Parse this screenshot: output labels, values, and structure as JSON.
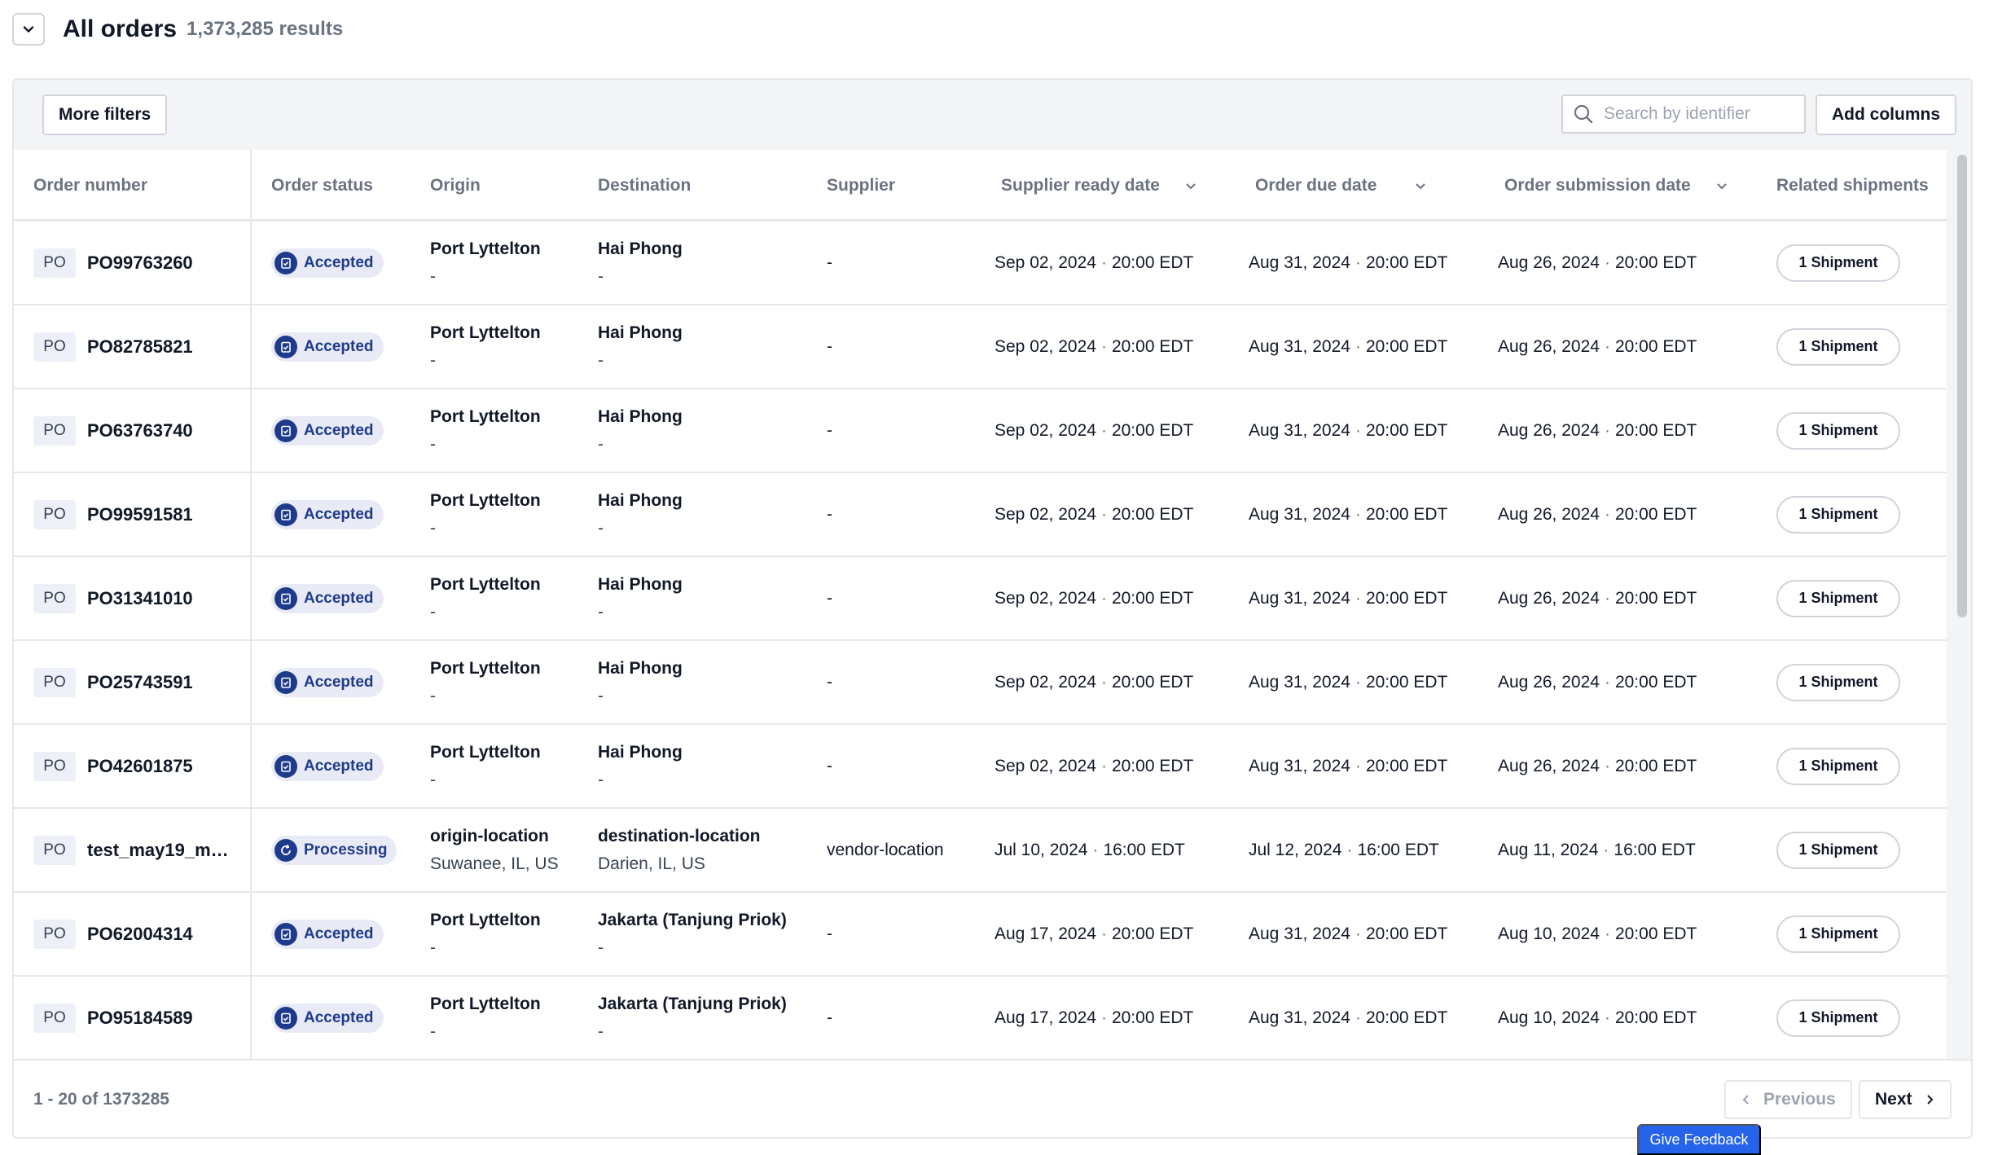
{
  "header": {
    "title": "All orders",
    "results": "1,373,285 results"
  },
  "toolbar": {
    "more_filters": "More filters",
    "search_placeholder": "Search by identifier",
    "add_columns": "Add columns"
  },
  "columns": {
    "order_number": "Order number",
    "order_status": "Order status",
    "origin": "Origin",
    "destination": "Destination",
    "supplier": "Supplier",
    "supplier_ready_date": "Supplier ready date",
    "order_due_date": "Order due date",
    "order_submission_date": "Order submission date",
    "related_shipments": "Related shipments"
  },
  "rows": [
    {
      "tag": "PO",
      "number": "PO99763260",
      "status": "Accepted",
      "status_icon": "clipboard-check-icon",
      "origin": "Port Lyttelton",
      "origin_sub": "-",
      "dest": "Hai Phong",
      "dest_sub": "-",
      "supplier": "-",
      "ready": "Sep 02, 2024",
      "ready_t": "20:00 EDT",
      "due": "Aug 31, 2024",
      "due_t": "20:00 EDT",
      "sub": "Aug 26, 2024",
      "sub_t": "20:00 EDT",
      "ship": "1 Shipment"
    },
    {
      "tag": "PO",
      "number": "PO82785821",
      "status": "Accepted",
      "status_icon": "clipboard-check-icon",
      "origin": "Port Lyttelton",
      "origin_sub": "-",
      "dest": "Hai Phong",
      "dest_sub": "-",
      "supplier": "-",
      "ready": "Sep 02, 2024",
      "ready_t": "20:00 EDT",
      "due": "Aug 31, 2024",
      "due_t": "20:00 EDT",
      "sub": "Aug 26, 2024",
      "sub_t": "20:00 EDT",
      "ship": "1 Shipment"
    },
    {
      "tag": "PO",
      "number": "PO63763740",
      "status": "Accepted",
      "status_icon": "clipboard-check-icon",
      "origin": "Port Lyttelton",
      "origin_sub": "-",
      "dest": "Hai Phong",
      "dest_sub": "-",
      "supplier": "-",
      "ready": "Sep 02, 2024",
      "ready_t": "20:00 EDT",
      "due": "Aug 31, 2024",
      "due_t": "20:00 EDT",
      "sub": "Aug 26, 2024",
      "sub_t": "20:00 EDT",
      "ship": "1 Shipment"
    },
    {
      "tag": "PO",
      "number": "PO99591581",
      "status": "Accepted",
      "status_icon": "clipboard-check-icon",
      "origin": "Port Lyttelton",
      "origin_sub": "-",
      "dest": "Hai Phong",
      "dest_sub": "-",
      "supplier": "-",
      "ready": "Sep 02, 2024",
      "ready_t": "20:00 EDT",
      "due": "Aug 31, 2024",
      "due_t": "20:00 EDT",
      "sub": "Aug 26, 2024",
      "sub_t": "20:00 EDT",
      "ship": "1 Shipment"
    },
    {
      "tag": "PO",
      "number": "PO31341010",
      "status": "Accepted",
      "status_icon": "clipboard-check-icon",
      "origin": "Port Lyttelton",
      "origin_sub": "-",
      "dest": "Hai Phong",
      "dest_sub": "-",
      "supplier": "-",
      "ready": "Sep 02, 2024",
      "ready_t": "20:00 EDT",
      "due": "Aug 31, 2024",
      "due_t": "20:00 EDT",
      "sub": "Aug 26, 2024",
      "sub_t": "20:00 EDT",
      "ship": "1 Shipment"
    },
    {
      "tag": "PO",
      "number": "PO25743591",
      "status": "Accepted",
      "status_icon": "clipboard-check-icon",
      "origin": "Port Lyttelton",
      "origin_sub": "-",
      "dest": "Hai Phong",
      "dest_sub": "-",
      "supplier": "-",
      "ready": "Sep 02, 2024",
      "ready_t": "20:00 EDT",
      "due": "Aug 31, 2024",
      "due_t": "20:00 EDT",
      "sub": "Aug 26, 2024",
      "sub_t": "20:00 EDT",
      "ship": "1 Shipment"
    },
    {
      "tag": "PO",
      "number": "PO42601875",
      "status": "Accepted",
      "status_icon": "clipboard-check-icon",
      "origin": "Port Lyttelton",
      "origin_sub": "-",
      "dest": "Hai Phong",
      "dest_sub": "-",
      "supplier": "-",
      "ready": "Sep 02, 2024",
      "ready_t": "20:00 EDT",
      "due": "Aug 31, 2024",
      "due_t": "20:00 EDT",
      "sub": "Aug 26, 2024",
      "sub_t": "20:00 EDT",
      "ship": "1 Shipment"
    },
    {
      "tag": "PO",
      "number": "test_may19_ma...",
      "status": "Processing",
      "status_icon": "refresh-icon",
      "origin": "origin-location",
      "origin_sub": "Suwanee, IL, US",
      "dest": "destination-location",
      "dest_sub": "Darien, IL, US",
      "supplier": "vendor-location",
      "ready": "Jul 10, 2024",
      "ready_t": "16:00 EDT",
      "due": "Jul 12, 2024",
      "due_t": "16:00 EDT",
      "sub": "Aug 11, 2024",
      "sub_t": "16:00 EDT",
      "ship": "1 Shipment"
    },
    {
      "tag": "PO",
      "number": "PO62004314",
      "status": "Accepted",
      "status_icon": "clipboard-check-icon",
      "origin": "Port Lyttelton",
      "origin_sub": "-",
      "dest": "Jakarta (Tanjung Priok)",
      "dest_sub": "-",
      "supplier": "-",
      "ready": "Aug 17, 2024",
      "ready_t": "20:00 EDT",
      "due": "Aug 31, 2024",
      "due_t": "20:00 EDT",
      "sub": "Aug 10, 2024",
      "sub_t": "20:00 EDT",
      "ship": "1 Shipment"
    },
    {
      "tag": "PO",
      "number": "PO95184589",
      "status": "Accepted",
      "status_icon": "clipboard-check-icon",
      "origin": "Port Lyttelton",
      "origin_sub": "-",
      "dest": "Jakarta (Tanjung Priok)",
      "dest_sub": "-",
      "supplier": "-",
      "ready": "Aug 17, 2024",
      "ready_t": "20:00 EDT",
      "due": "Aug 31, 2024",
      "due_t": "20:00 EDT",
      "sub": "Aug 10, 2024",
      "sub_t": "20:00 EDT",
      "ship": "1 Shipment"
    }
  ],
  "pagination": {
    "range": "1 - 20 of 1373285",
    "previous": "Previous",
    "next": "Next"
  },
  "feedback": "Give Feedback",
  "colors": {
    "accent": "#1e3a8a",
    "status_bg": "#e8ebf6",
    "feedback": "#2563eb"
  }
}
